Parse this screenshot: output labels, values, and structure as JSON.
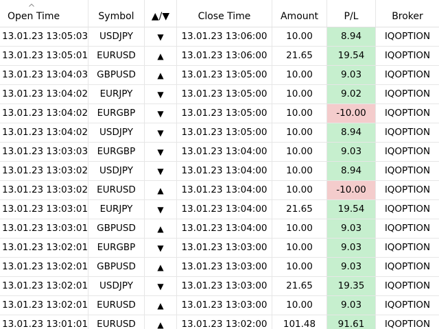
{
  "table": {
    "columns": {
      "open_time": "Open Time",
      "symbol": "Symbol",
      "direction": "▲/▼",
      "close_time": "Close Time",
      "amount": "Amount",
      "pl": "P/L",
      "broker": "Broker"
    },
    "sort": {
      "column": "open_time",
      "order": "descending"
    },
    "colors": {
      "profit_bg": "#c6efce",
      "loss_bg": "#f4cccc"
    },
    "rows": [
      {
        "open": "13.01.23 13:05:03",
        "symbol": "USDJPY",
        "dir": "down",
        "dir_glyph": "▼",
        "close": "13.01.23 13:06:00",
        "amount": "10.00",
        "pl": "8.94",
        "broker": "IQOPTION"
      },
      {
        "open": "13.01.23 13:05:01",
        "symbol": "EURUSD",
        "dir": "up",
        "dir_glyph": "▲",
        "close": "13.01.23 13:06:00",
        "amount": "21.65",
        "pl": "19.54",
        "broker": "IQOPTION"
      },
      {
        "open": "13.01.23 13:04:03",
        "symbol": "GBPUSD",
        "dir": "up",
        "dir_glyph": "▲",
        "close": "13.01.23 13:05:00",
        "amount": "10.00",
        "pl": "9.03",
        "broker": "IQOPTION"
      },
      {
        "open": "13.01.23 13:04:02",
        "symbol": "EURJPY",
        "dir": "down",
        "dir_glyph": "▼",
        "close": "13.01.23 13:05:00",
        "amount": "10.00",
        "pl": "9.02",
        "broker": "IQOPTION"
      },
      {
        "open": "13.01.23 13:04:02",
        "symbol": "EURGBP",
        "dir": "down",
        "dir_glyph": "▼",
        "close": "13.01.23 13:05:00",
        "amount": "10.00",
        "pl": "-10.00",
        "broker": "IQOPTION"
      },
      {
        "open": "13.01.23 13:04:02",
        "symbol": "USDJPY",
        "dir": "down",
        "dir_glyph": "▼",
        "close": "13.01.23 13:05:00",
        "amount": "10.00",
        "pl": "8.94",
        "broker": "IQOPTION"
      },
      {
        "open": "13.01.23 13:03:03",
        "symbol": "EURGBP",
        "dir": "down",
        "dir_glyph": "▼",
        "close": "13.01.23 13:04:00",
        "amount": "10.00",
        "pl": "9.03",
        "broker": "IQOPTION"
      },
      {
        "open": "13.01.23 13:03:02",
        "symbol": "USDJPY",
        "dir": "down",
        "dir_glyph": "▼",
        "close": "13.01.23 13:04:00",
        "amount": "10.00",
        "pl": "8.94",
        "broker": "IQOPTION"
      },
      {
        "open": "13.01.23 13:03:02",
        "symbol": "EURUSD",
        "dir": "up",
        "dir_glyph": "▲",
        "close": "13.01.23 13:04:00",
        "amount": "10.00",
        "pl": "-10.00",
        "broker": "IQOPTION"
      },
      {
        "open": "13.01.23 13:03:01",
        "symbol": "EURJPY",
        "dir": "down",
        "dir_glyph": "▼",
        "close": "13.01.23 13:04:00",
        "amount": "21.65",
        "pl": "19.54",
        "broker": "IQOPTION"
      },
      {
        "open": "13.01.23 13:03:01",
        "symbol": "GBPUSD",
        "dir": "up",
        "dir_glyph": "▲",
        "close": "13.01.23 13:04:00",
        "amount": "10.00",
        "pl": "9.03",
        "broker": "IQOPTION"
      },
      {
        "open": "13.01.23 13:02:01",
        "symbol": "EURGBP",
        "dir": "down",
        "dir_glyph": "▼",
        "close": "13.01.23 13:03:00",
        "amount": "10.00",
        "pl": "9.03",
        "broker": "IQOPTION"
      },
      {
        "open": "13.01.23 13:02:01",
        "symbol": "GBPUSD",
        "dir": "up",
        "dir_glyph": "▲",
        "close": "13.01.23 13:03:00",
        "amount": "10.00",
        "pl": "9.03",
        "broker": "IQOPTION"
      },
      {
        "open": "13.01.23 13:02:01",
        "symbol": "USDJPY",
        "dir": "down",
        "dir_glyph": "▼",
        "close": "13.01.23 13:03:00",
        "amount": "21.65",
        "pl": "19.35",
        "broker": "IQOPTION"
      },
      {
        "open": "13.01.23 13:02:01",
        "symbol": "EURUSD",
        "dir": "up",
        "dir_glyph": "▲",
        "close": "13.01.23 13:03:00",
        "amount": "10.00",
        "pl": "9.03",
        "broker": "IQOPTION"
      },
      {
        "open": "13.01.23 13:01:01",
        "symbol": "EURUSD",
        "dir": "up",
        "dir_glyph": "▲",
        "close": "13.01.23 13:02:00",
        "amount": "101.48",
        "pl": "91.61",
        "broker": "IQOPTION"
      }
    ]
  }
}
